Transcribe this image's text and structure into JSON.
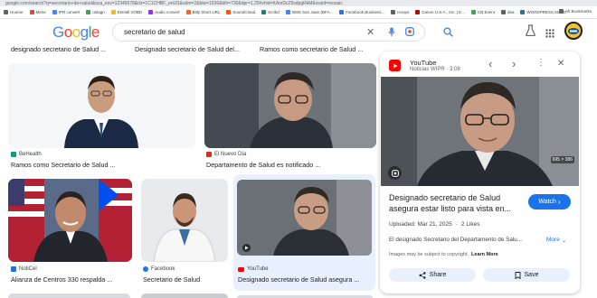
{
  "url": "google.com/search?q=secretario+de+salud&sca_esv=12345678&rlz=1C1CHBF_enUS&udm=2&biw=1536&bih=730&dpr=1.25#vhid=KAmDcZ9sdpgRkM&vssid=mosaic",
  "bookmarks": [
    {
      "label": "Hoome",
      "color": "#5f6368"
    },
    {
      "label": "Mene",
      "color": "#ea4335"
    },
    {
      "label": "IPR convert",
      "color": "#4285f4"
    },
    {
      "label": "unlagn",
      "color": "#34a853"
    },
    {
      "label": "EeHall VOBD",
      "color": "#fbbc04"
    },
    {
      "label": "Audio convert",
      "color": "#9334e6"
    },
    {
      "label": "Bitly Short URL",
      "color": "#ee6723"
    },
    {
      "label": "SoundCloud",
      "color": "#ff5500"
    },
    {
      "label": "Scribd",
      "color": "#1e7b85"
    },
    {
      "label": "NMS San Juan (BFA...",
      "color": "#4285f4"
    },
    {
      "label": "Facebook Business...",
      "color": "#1877f2"
    },
    {
      "label": "Hoops",
      "color": "#5f6368"
    },
    {
      "label": "Canon U.S.A., Inc. | E...",
      "color": "#cc0000"
    },
    {
      "label": "CB Event",
      "color": "#34a853"
    },
    {
      "label": "dea",
      "color": "#5f6368"
    },
    {
      "label": "WORDPRESS MALO",
      "color": "#21759b"
    }
  ],
  "all_bookmarks_label": "All Bookmarks",
  "logo": {
    "letters": [
      "G",
      "o",
      "o",
      "g",
      "l",
      "e"
    ],
    "colors": [
      "#4285f4",
      "#ea4335",
      "#fbbc05",
      "#4285f4",
      "#34a853",
      "#ea4335"
    ]
  },
  "search": {
    "query": "secretario de salud"
  },
  "row0": [
    {
      "title": "designado secretario de Salud ..."
    },
    {
      "title": "Designado secretario de Salud del..."
    },
    {
      "title": "Ramos como secretario de Salud ..."
    }
  ],
  "row1": [
    {
      "source": "BeHealth",
      "title": "Ramos como Secretario de Salud ...",
      "src_color": "#00a37a"
    },
    {
      "source": "El Nuevo Día",
      "title": "Departamento de Salud es notificado ...",
      "src_color": "#d93025"
    }
  ],
  "row2": [
    {
      "source": "NotiCel",
      "title": "Alianza de Centros 330 respalda ...",
      "src_color": "#1a73e8"
    },
    {
      "source": "Facebook",
      "title": "Secretario de Salud",
      "src_color": "#1877f2"
    },
    {
      "source": "YouTube",
      "title": "Designado secretario de Salud asegura ...",
      "src_color": "#ff0000"
    }
  ],
  "panel": {
    "source": "YouTube",
    "subtitle": "Noticias WIPR · 3:08",
    "dims": "695 × 386",
    "title": "Designado secretario de Salud asegura estar listo para vista en...",
    "visit_label": "Watch",
    "uploaded": "Uploaded: Mar 21, 2025",
    "likes": "2 Likes",
    "description": "El designado Secretario del Departamento de Salu...",
    "more_label": "More",
    "copyright": "Images may be subject to copyright.",
    "learn_more": "Learn More",
    "share_label": "Share",
    "save_label": "Save"
  }
}
